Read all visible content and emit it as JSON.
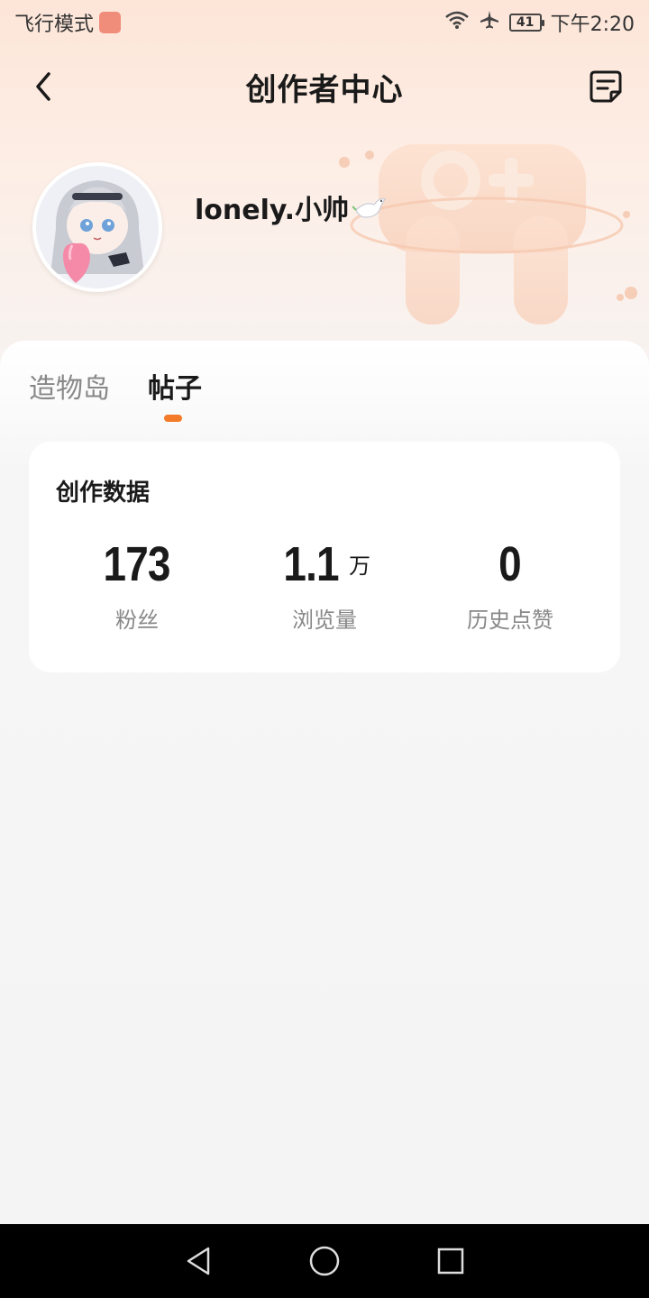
{
  "status": {
    "mode": "飞行模式",
    "battery": "41",
    "time": "下午2:20"
  },
  "header": {
    "title": "创作者中心"
  },
  "profile": {
    "username": "lonely.小帅"
  },
  "tabs": [
    {
      "label": "造物岛",
      "active": false
    },
    {
      "label": "帖子",
      "active": true
    }
  ],
  "card": {
    "title": "创作数据",
    "stats": [
      {
        "value": "173",
        "unit": "",
        "label": "粉丝"
      },
      {
        "value": "1.1",
        "unit": "万",
        "label": "浏览量"
      },
      {
        "value": "0",
        "unit": "",
        "label": "历史点赞"
      }
    ]
  },
  "colors": {
    "accent": "#f37b2a",
    "hero_top": "#fde5d8"
  },
  "icons": [
    "back-icon",
    "note-edit-icon",
    "wifi-icon",
    "airplane-icon",
    "dove-icon",
    "nav-back-icon",
    "nav-home-icon",
    "nav-recent-icon"
  ]
}
